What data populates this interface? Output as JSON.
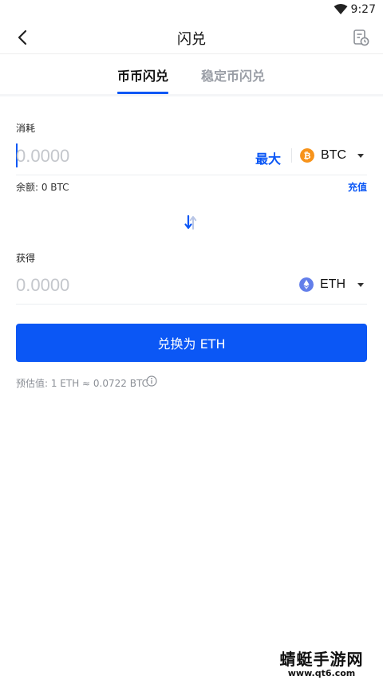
{
  "status_bar": {
    "time": "9:27"
  },
  "header": {
    "title": "闪兑"
  },
  "tabs": [
    {
      "label": "币币闪兑",
      "active": true
    },
    {
      "label": "稳定币闪兑",
      "active": false
    }
  ],
  "pay": {
    "label": "消耗",
    "amount_placeholder": "0.0000",
    "max_label": "最大",
    "coin": "BTC",
    "balance": "余额: 0 BTC",
    "recharge_label": "充值"
  },
  "receive": {
    "label": "获得",
    "amount_placeholder": "0.0000",
    "coin": "ETH"
  },
  "convert_button": "兑换为 ETH",
  "estimate": "预估值:  1 ETH ≈ 0.0722 BTC",
  "watermark": {
    "title": "蜻蜓手游网",
    "url": "www.qt6.com"
  },
  "colors": {
    "accent": "#0b57f5",
    "btc": "#f7931a",
    "eth": "#627eea"
  }
}
